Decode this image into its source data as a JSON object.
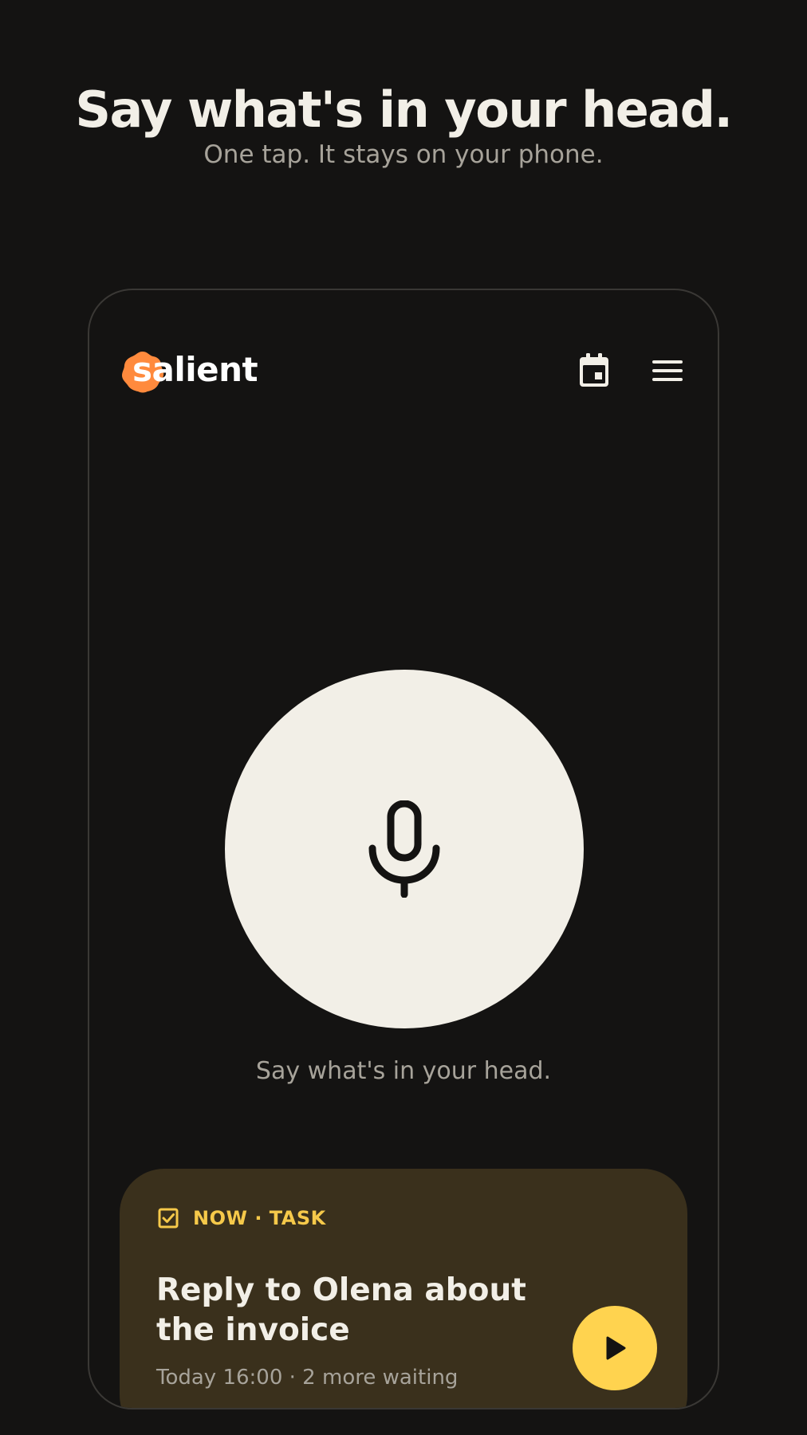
{
  "hero": {
    "title": "Say what's in your head.",
    "subtitle": "One tap. It stays on your phone."
  },
  "app": {
    "logo_text": "salient",
    "header_icons": [
      "calendar-icon",
      "menu-icon"
    ]
  },
  "recorder": {
    "icon": "microphone-icon",
    "hint": "Say what's in your head."
  },
  "task_card": {
    "tag_icon": "checkbox-icon",
    "tag": "NOW · TASK",
    "title": "Reply to Olena about the invoice",
    "meta": "Today 16:00 · 2 more waiting",
    "action_icon": "play-icon"
  },
  "colors": {
    "background": "#141312",
    "foreground": "#f2efe7",
    "muted": "#a7a39a",
    "brand_orange": "#ff8a3d",
    "card_bg": "#3a301c",
    "accent_yellow": "#ffd34f"
  }
}
